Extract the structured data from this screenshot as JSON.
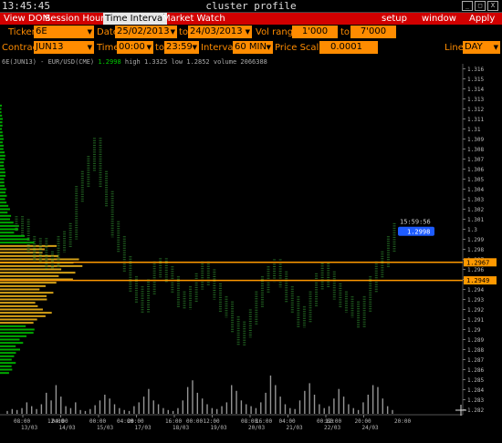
{
  "window": {
    "clock": "13:45:45",
    "title": "cluster profile",
    "buttons": [
      "_",
      "□",
      "X"
    ]
  },
  "menu": {
    "items": [
      "View DOM",
      "Session Hours",
      "Time Interval",
      "Market Watch"
    ],
    "active": "Time Interval",
    "right_items": [
      "setup",
      "window",
      "Apply"
    ]
  },
  "settings": {
    "ticker_label": "Ticker",
    "ticker_value": "6E",
    "date_label": "Date",
    "date_from": "25/02/2013",
    "date_to_label": "to",
    "date_to": "24/03/2013",
    "vol_range_label": "Vol range",
    "vol_from": "1'000",
    "vol_to_label": "to",
    "vol_to": "7'000",
    "contract_label": "Contract",
    "contract_value": "JUN13",
    "time_label": "Time",
    "time_from": "00:00",
    "time_to_label": "to",
    "time_to": "23:59",
    "interval_label": "Interval",
    "interval_value": "60 MIN",
    "price_scale_label": "Price Scale",
    "price_scale_value": "0.0001",
    "line_label": "Line",
    "line_value": "DAY"
  },
  "chart_header": {
    "symbol": "6E(JUN13) - EUR/USD(CME)",
    "last": "1.2998",
    "high_label": "high",
    "high": "1.3325",
    "low_label": "low",
    "low": "1.2852",
    "volume_label": "volume",
    "volume": "2066388"
  },
  "chart_data": {
    "type": "bar",
    "price_axis_ticks": [
      "1.316",
      "1.315",
      "1.314",
      "1.313",
      "1.312",
      "1.311",
      "1.31",
      "1.309",
      "1.308",
      "1.307",
      "1.306",
      "1.305",
      "1.304",
      "1.303",
      "1.302",
      "1.301",
      "1.3",
      "1.299",
      "1.298",
      "1.297",
      "1.296",
      "1.295",
      "1.294",
      "1.293",
      "1.292",
      "1.291",
      "1.29",
      "1.289",
      "1.288",
      "1.287",
      "1.286",
      "1.285",
      "1.284",
      "1.283",
      "1.282"
    ],
    "ylim": [
      1.2815,
      1.3165
    ],
    "time_axis_labels": [
      {
        "time": "08:00",
        "date": "13/03"
      },
      {
        "time": "04:00",
        "date": "14/03"
      },
      {
        "time": "00:00",
        "date": "15/03"
      },
      {
        "time": "20:00",
        "date": "17/03"
      },
      {
        "time": "16:00",
        "date": "18/03"
      },
      {
        "time": "12:00",
        "date": "19/03"
      },
      {
        "time": "08:00",
        "date": "20/03"
      },
      {
        "time": "04:00",
        "date": "21/03"
      },
      {
        "time": "00:00",
        "date": "22/03"
      },
      {
        "time": "20:00",
        "date": "24/03"
      }
    ],
    "extra_time_ticks": [
      "12:00",
      "04:00",
      "00:00",
      "16:00",
      "12:00",
      "20:00"
    ],
    "last_price": 1.2998,
    "last_time": "15:59:56",
    "levels": [
      1.2967,
      1.2949
    ],
    "level_labels": [
      "1.2967",
      "1.2949"
    ],
    "colors": {
      "background": "#000000",
      "menu": "#d10000",
      "field": "#ff8c00",
      "level": "#ff9900",
      "volume_profile_low": "#00aa00",
      "volume_profile_mid": "#d4a017",
      "price_marker": "#1e5cff",
      "bars": "#2a7a2a",
      "volume_bars": "#bbbbbb"
    },
    "volume_profile": [
      {
        "price": 1.312,
        "value": 2
      },
      {
        "price": 1.311,
        "value": 3
      },
      {
        "price": 1.31,
        "value": 3
      },
      {
        "price": 1.309,
        "value": 4
      },
      {
        "price": 1.308,
        "value": 5
      },
      {
        "price": 1.307,
        "value": 6
      },
      {
        "price": 1.306,
        "value": 6
      },
      {
        "price": 1.305,
        "value": 6
      },
      {
        "price": 1.304,
        "value": 7
      },
      {
        "price": 1.303,
        "value": 8
      },
      {
        "price": 1.302,
        "value": 11
      },
      {
        "price": 1.301,
        "value": 15
      },
      {
        "price": 1.3,
        "value": 22
      },
      {
        "price": 1.299,
        "value": 38
      },
      {
        "price": 1.298,
        "value": 62
      },
      {
        "price": 1.297,
        "value": 90
      },
      {
        "price": 1.296,
        "value": 95
      },
      {
        "price": 1.295,
        "value": 80
      },
      {
        "price": 1.294,
        "value": 60
      },
      {
        "price": 1.293,
        "value": 55
      },
      {
        "price": 1.292,
        "value": 57
      },
      {
        "price": 1.291,
        "value": 50
      },
      {
        "price": 1.29,
        "value": 40
      },
      {
        "price": 1.289,
        "value": 30
      },
      {
        "price": 1.288,
        "value": 22
      },
      {
        "price": 1.287,
        "value": 18
      },
      {
        "price": 1.286,
        "value": 14
      }
    ],
    "volume_bars": [
      3,
      5,
      4,
      6,
      12,
      8,
      5,
      10,
      22,
      14,
      30,
      18,
      8,
      6,
      12,
      4,
      3,
      5,
      9,
      14,
      20,
      16,
      10,
      6,
      4,
      3,
      8,
      12,
      18,
      26,
      14,
      10,
      6,
      4,
      3,
      6,
      14,
      28,
      35,
      22,
      16,
      10,
      6,
      5,
      8,
      12,
      30,
      24,
      14,
      10,
      8,
      6,
      12,
      22,
      40,
      30,
      18,
      10,
      6,
      5,
      14,
      24,
      32,
      20,
      10,
      6,
      8,
      16,
      26,
      18,
      10,
      6,
      4,
      12,
      20,
      30,
      28,
      16,
      8,
      4
    ],
    "price_series": [
      1.3005,
      1.3002,
      1.2985,
      1.2975,
      1.2983,
      1.2968,
      1.297,
      1.2985,
      1.299,
      1.2998,
      1.3035,
      1.305,
      1.3065,
      1.3083,
      1.305,
      1.303,
      1.3,
      1.2985,
      1.2965,
      1.2945,
      1.2935,
      1.2925,
      1.2942,
      1.296,
      1.2963,
      1.2955,
      1.2945,
      1.293,
      1.2928,
      1.2935,
      1.2948,
      1.296,
      1.2952,
      1.2938,
      1.2925,
      1.292,
      1.2905,
      1.2892,
      1.29,
      1.2912,
      1.293,
      1.2945,
      1.2955,
      1.2962,
      1.295,
      1.2935,
      1.2925,
      1.291,
      1.2915,
      1.293,
      1.2948,
      1.2958,
      1.295,
      1.2938,
      1.293,
      1.2925,
      1.292,
      1.291,
      1.2925,
      1.2945,
      1.296,
      1.297,
      1.2985,
      1.2998
    ]
  }
}
